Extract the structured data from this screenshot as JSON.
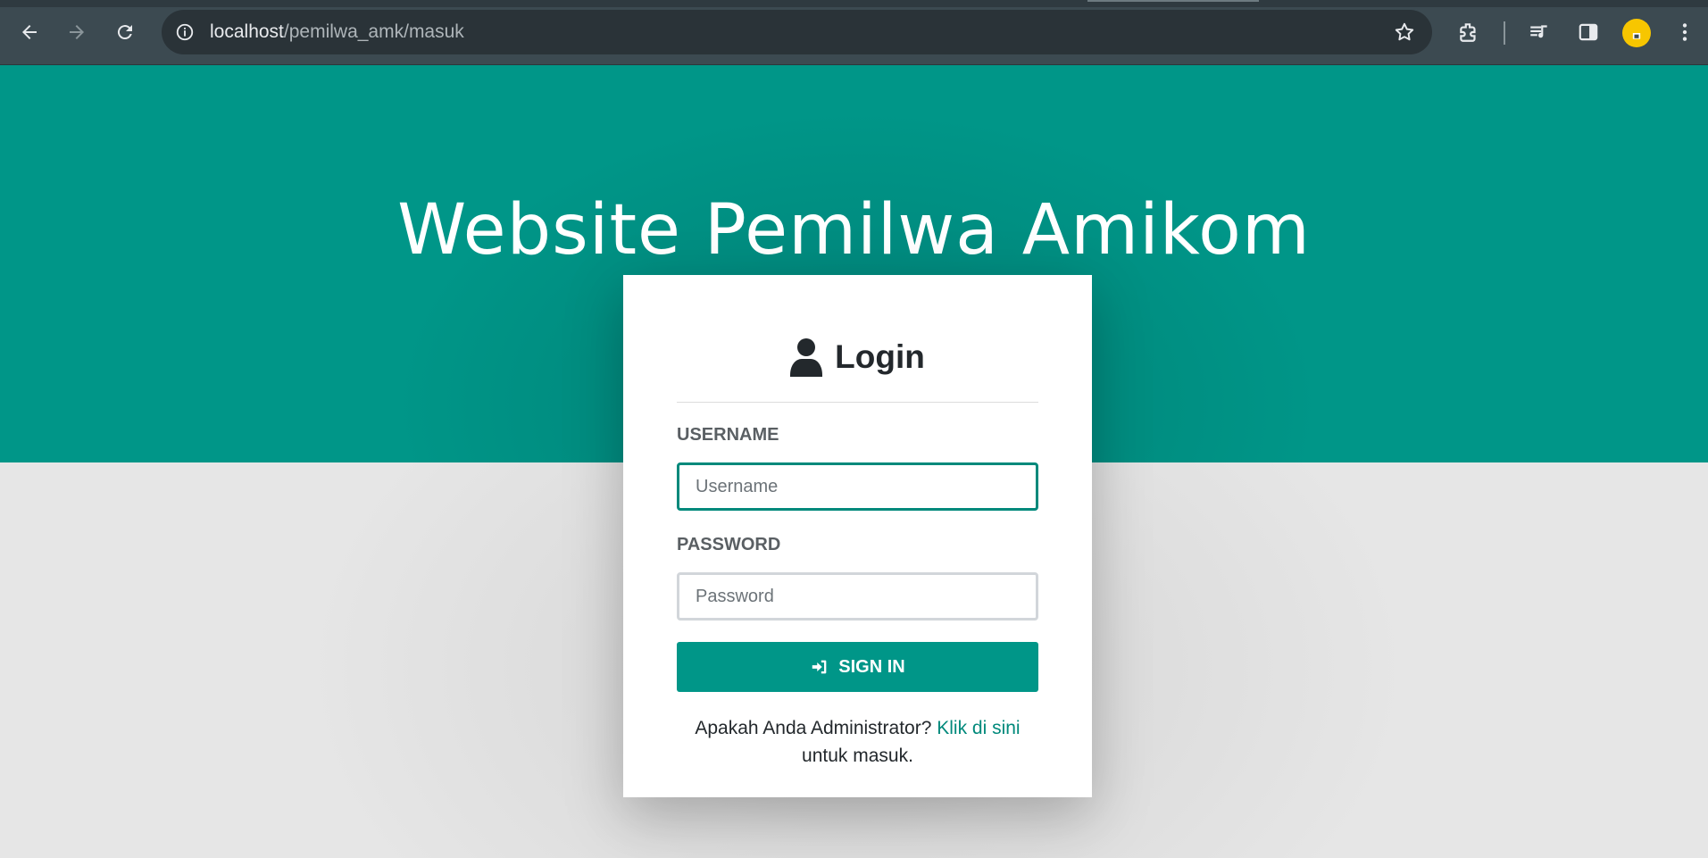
{
  "browser": {
    "url_host": "localhost",
    "url_path": "/pemilwa_amk/masuk",
    "icons": [
      "back-arrow-icon",
      "forward-arrow-icon",
      "reload-icon",
      "info-icon",
      "star-icon",
      "extensions-icon",
      "media-queue-icon",
      "side-panel-icon",
      "profile-icon",
      "kebab-menu-icon"
    ]
  },
  "hero": {
    "title": "Website Pemilwa Amikom"
  },
  "login": {
    "heading": "Login",
    "username_label": "USERNAME",
    "username_placeholder": "Username",
    "password_label": "PASSWORD",
    "password_placeholder": "Password",
    "signin_label": "SIGN IN",
    "admin_prefix": "Apakah Anda Administrator?",
    "admin_link": "Klik di sini",
    "admin_suffix": "untuk masuk."
  },
  "colors": {
    "primary": "#009688",
    "chrome": "#3c4a51",
    "background": "#e6e6e6"
  }
}
